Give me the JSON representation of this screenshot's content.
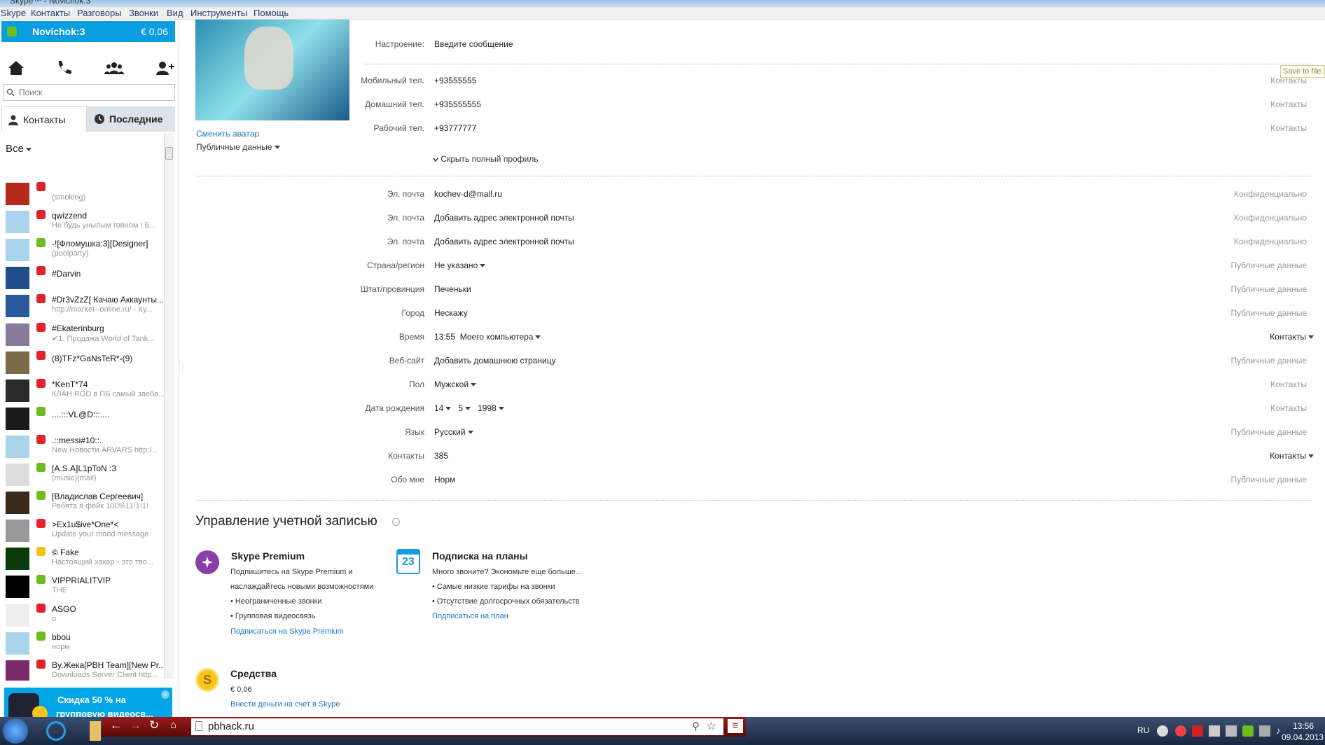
{
  "window": {
    "title": "Skype™ - Novichok.3"
  },
  "menu": {
    "items": [
      "Skype",
      "Контакты",
      "Разговоры",
      "Звонки",
      "Вид",
      "Инструменты",
      "Помощь"
    ]
  },
  "user": {
    "name": "Novichok:3",
    "balance": "€ 0,06"
  },
  "search": {
    "placeholder": "Поиск"
  },
  "tabs": {
    "contacts": "Контакты",
    "recent": "Последние"
  },
  "filter": {
    "label": "Все"
  },
  "contacts": [
    {
      "name": "",
      "mood": "(smoking)",
      "status": "red",
      "avatar": "#b52a1a"
    },
    {
      "name": "qwizzend",
      "mood": "Не будь унылым говном ! Б...",
      "status": "red",
      "avatar": "#a9d4ec"
    },
    {
      "name": "-![Фломушка:3][Designer]",
      "mood": "(poolparty)",
      "status": "grn",
      "avatar": "#a9d4ec"
    },
    {
      "name": "#Darvin",
      "mood": "",
      "status": "red",
      "avatar": "#1f4e8a"
    },
    {
      "name": "#Dr3vZzZ[ Качаю Аккаунты...",
      "mood": "http://market--online.ru/ - Ку...",
      "status": "red",
      "avatar": "#2a5a9e"
    },
    {
      "name": "#Ekaterinburg",
      "mood": "✔1. Продажа World of Tank...",
      "status": "red",
      "avatar": "#8a7a9a"
    },
    {
      "name": "(8)TFz*GaNsTeR*-(9)",
      "mood": "",
      "status": "red",
      "avatar": "#7a6a4a"
    },
    {
      "name": "*KenT*74",
      "mood": "КЛАН RGD в ПБ самый заеба...",
      "status": "red",
      "avatar": "#2a2a2a"
    },
    {
      "name": "....:::VL@D:::....",
      "mood": "",
      "status": "grn",
      "avatar": "#1a1a1a"
    },
    {
      "name": ".::messi#10::.",
      "mood": "New Новости ARVARS http:/...",
      "status": "red",
      "avatar": "#a9d4ec"
    },
    {
      "name": "[A.S.A]L1pToN :3",
      "mood": "(music)(mail)",
      "status": "grn",
      "avatar": "#ddd"
    },
    {
      "name": "[Владислав Сергеевич]",
      "mood": "Ребята я фейк 100%11!1!1!",
      "status": "grn",
      "avatar": "#3a2a1a"
    },
    {
      "name": ">Ex1u$ive*One*<",
      "mood": "Update your mood message",
      "status": "red",
      "avatar": "#999"
    },
    {
      "name": "© Fake",
      "mood": "Настоящий хакер - это тво...",
      "status": "yel",
      "avatar": "#0a3a0a"
    },
    {
      "name": "VIPPRIALITVIP",
      "mood": "THE",
      "status": "grn",
      "avatar": "#000"
    },
    {
      "name": "ASGO",
      "mood": "о",
      "status": "red",
      "avatar": "#eee"
    },
    {
      "name": "bbou",
      "mood": "норм",
      "status": "grn",
      "avatar": "#a9d4ec"
    },
    {
      "name": "By.Жека[PBH Team][New Pr...",
      "mood": "Downloads Server Client http...",
      "status": "red",
      "avatar": "#7a2a6a"
    }
  ],
  "promo": {
    "text1": "Скидка 50 % на",
    "text2": "групповую видеосв..."
  },
  "profile": {
    "change_avatar": "Сменить аватар",
    "public_data": "Публичные данные",
    "mood_label": "Настроение:",
    "mood_value": "Введите сообщение",
    "save_tooltip": "Save to file...",
    "phones": [
      {
        "label": "Мобильный тел.",
        "value": "+93555555",
        "privacy": "Контакты"
      },
      {
        "label": "Домашний тел.",
        "value": "+935555555",
        "privacy": "Контакты"
      },
      {
        "label": "Рабочий тел.",
        "value": "+93777777",
        "privacy": "Контакты"
      }
    ],
    "hide_profile": "Скрыть полный профиль",
    "fields": [
      {
        "label": "Эл. почта",
        "value": "kochev-d@mail.ru",
        "privacy": "Конфиденциально"
      },
      {
        "label": "Эл. почта",
        "value": "Добавить адрес электронной почты",
        "privacy": "Конфиденциально"
      },
      {
        "label": "Эл. почта",
        "value": "Добавить адрес электронной почты",
        "privacy": "Конфиденциально"
      },
      {
        "label": "Страна/регион",
        "value": "Не указано",
        "privacy": "Публичные данные"
      },
      {
        "label": "Штат/провинция",
        "value": "Печеньки",
        "privacy": "Публичные данные"
      },
      {
        "label": "Город",
        "value": "Нескажу",
        "privacy": "Публичные данные"
      },
      {
        "label": "Время",
        "value": "13:55",
        "value2": "Моего компьютера",
        "privacy": "Контакты"
      },
      {
        "label": "Веб-сайт",
        "value": "Добавить домашнюю страницу",
        "privacy": "Публичные данные"
      },
      {
        "label": "Пол",
        "value": "Мужской",
        "privacy": "Контакты"
      },
      {
        "label": "Дата рождения",
        "day": "14",
        "month": "5",
        "year": "1998",
        "privacy": "Контакты"
      },
      {
        "label": "Язык",
        "value": "Русский",
        "privacy": "Публичные данные"
      },
      {
        "label": "Контакты",
        "value": "385",
        "privacy": "Контакты"
      },
      {
        "label": "Обо мне",
        "value": "Норм",
        "privacy": "Публичные данные"
      }
    ]
  },
  "account": {
    "title": "Управление учетной записью",
    "premium": {
      "title": "Skype Premium",
      "line1": "Подпишитесь на Skype Premium и",
      "line2": "наслаждайтесь новыми возможностями",
      "b1": "• Неограниченные звонки",
      "b2": "• Групповая видеосвязь",
      "link": "Подписаться на Skype Premium"
    },
    "plans": {
      "title": "Подписка на планы",
      "line1": "Много звоните? Экономьте еще больше...",
      "b1": "• Самые низкие тарифы на звонки",
      "b2": "• Отсутствие долгосрочных обязательств",
      "link": "Подписаться на план",
      "day": "23"
    },
    "funds": {
      "title": "Средства",
      "value": "€ 0,06",
      "link": "Внести деньги на счет в Skype"
    }
  },
  "browser": {
    "url": "pbhack.ru"
  },
  "taskbar": {
    "lang": "RU",
    "time": "13:56",
    "date": "09.04.2013"
  }
}
